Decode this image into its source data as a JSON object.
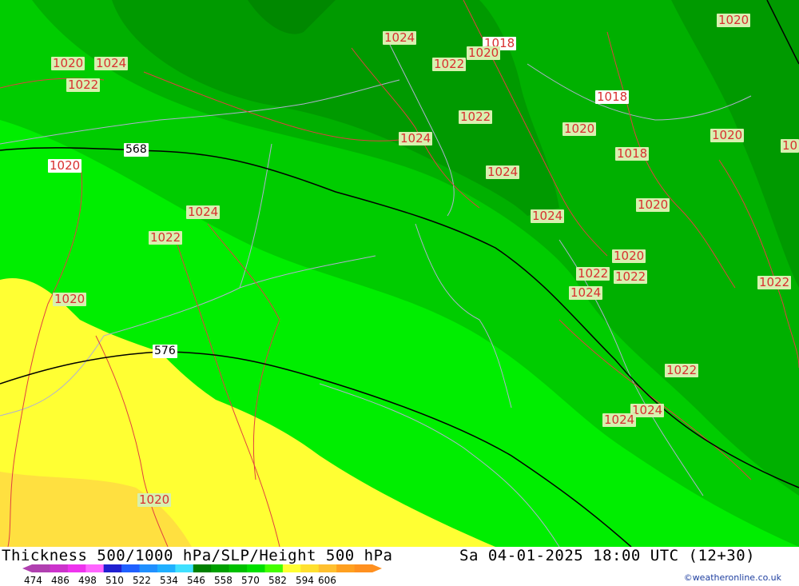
{
  "map": {
    "contour_labels": {
      "slp": [
        "1020",
        "1024",
        "1022",
        "1024",
        "1018",
        "1020",
        "1022",
        "1022",
        "1024",
        "1018",
        "1020",
        "1020",
        "1018",
        "1020",
        "1024",
        "1024",
        "1020",
        "1024",
        "1022",
        "1020",
        "1022",
        "1022",
        "1020",
        "1024",
        "1022",
        "1024",
        "1022",
        "1024",
        "1020",
        "1020",
        "1022",
        "1018",
        "10"
      ],
      "height": [
        "568",
        "576"
      ]
    },
    "colors": {
      "yellow_576_582": "#ffff33",
      "gold_582_588": "#ffe040",
      "green_570_576": "#00ee00",
      "green_564_570": "#00cc00",
      "green_558_564": "#00b000",
      "green_552_558": "#009a00",
      "isobar": "#e04040",
      "border": "#b0b0d0"
    }
  },
  "footer": {
    "title": "Thickness 500/1000 hPa/SLP/Height 500 hPa",
    "valid_time": "Sa 04-01-2025 18:00 UTC (12+30)",
    "credit": "©weatheronline.co.uk",
    "scale_values": [
      "474",
      "486",
      "498",
      "510",
      "522",
      "534",
      "546",
      "558",
      "570",
      "582",
      "594",
      "606"
    ],
    "scale_colors": [
      "#b040b0",
      "#cc33cc",
      "#ee33ee",
      "#ff66ff",
      "#2020d0",
      "#2060ff",
      "#2090ff",
      "#20b0ff",
      "#40e0ff",
      "#008000",
      "#00a000",
      "#00c000",
      "#00e000",
      "#44ff00",
      "#ffff33",
      "#ffe030",
      "#ffc030",
      "#ffa020",
      "#ff9020"
    ]
  }
}
